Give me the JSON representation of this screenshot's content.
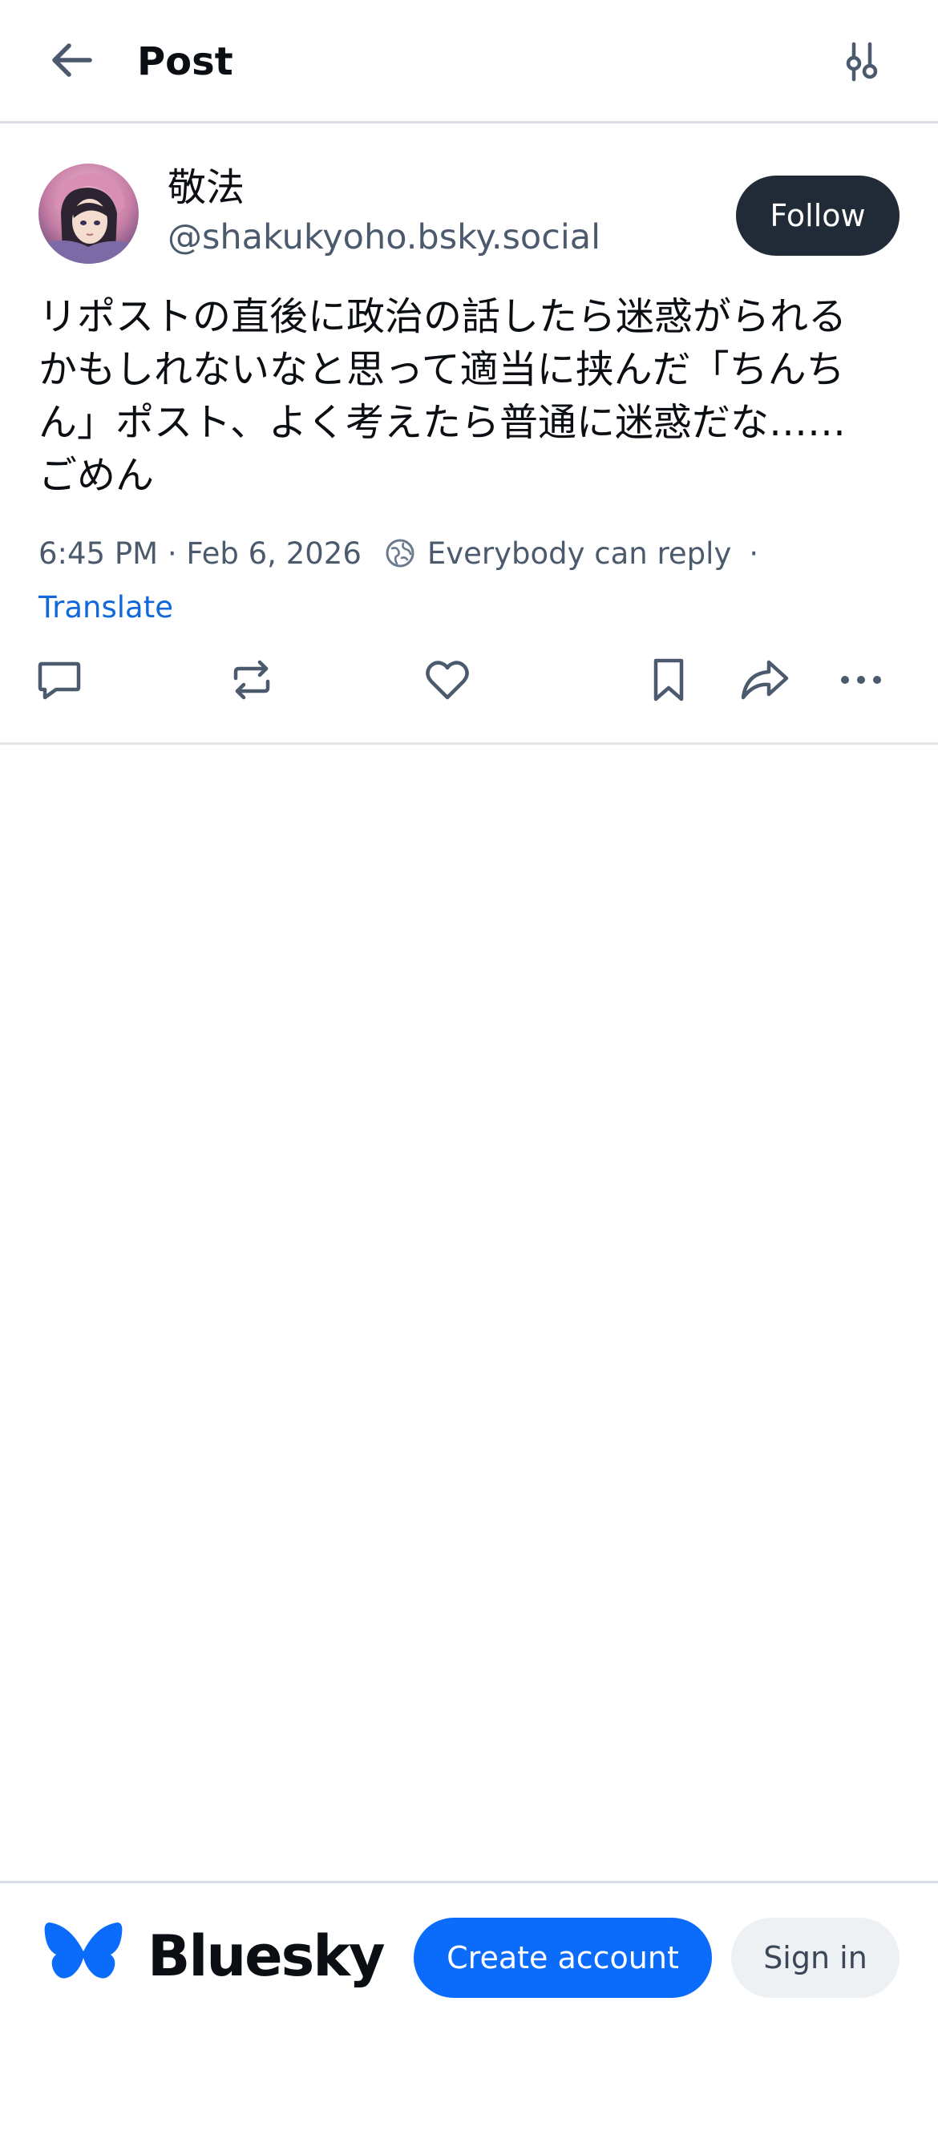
{
  "header": {
    "title": "Post",
    "back_icon": "arrow-left-icon",
    "filter_icon": "sliders-icon"
  },
  "post": {
    "author": {
      "display_name": "敬法",
      "handle": "@shakukyoho.bsky.social"
    },
    "follow_label": "Follow",
    "text": "リポストの直後に政治の話したら迷惑がられる\nかもしれないなと思って適当に挟んだ「ちんち\nん」ポスト、よく考えたら普通に迷惑だな……\nごめん",
    "timestamp": "6:45 PM · Feb 6, 2026",
    "reply_setting": "Everybody can reply",
    "separator": "·",
    "translate_label": "Translate",
    "actions": [
      {
        "name": "reply",
        "icon": "speech-bubble-icon"
      },
      {
        "name": "repost",
        "icon": "repost-icon"
      },
      {
        "name": "like",
        "icon": "heart-icon"
      },
      {
        "name": "bookmark",
        "icon": "bookmark-icon"
      },
      {
        "name": "share",
        "icon": "share-arrow-icon"
      },
      {
        "name": "more",
        "icon": "ellipsis-icon"
      }
    ]
  },
  "footer": {
    "brand": "Bluesky",
    "create_account_label": "Create account",
    "sign_in_label": "Sign in"
  },
  "colors": {
    "accent": "#0b6cfc",
    "link": "#1168db",
    "follow_button_bg": "#212a37",
    "muted_text": "#4b5a6c",
    "icon": "#4b5a6c"
  }
}
